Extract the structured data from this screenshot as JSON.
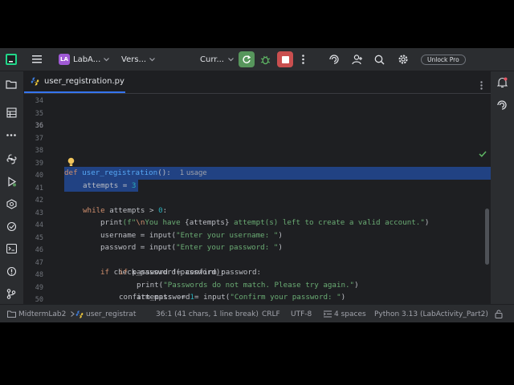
{
  "titlebar": {
    "project_badge": "LA",
    "project_name": "LabA...",
    "vcs_label": "Vers...",
    "run_config": "Curr...",
    "unlock_label": "Unlock Pro"
  },
  "tab": {
    "filename": "user_registration.py"
  },
  "editor": {
    "line_numbers": [
      "34",
      "35",
      "36",
      "37",
      "38",
      "39",
      "40",
      "41",
      "42",
      "43",
      "44",
      "45",
      "46",
      "47",
      "48",
      "49",
      "50",
      "51"
    ],
    "current_line": "36",
    "usage_hint": "1 usage",
    "code": {
      "l36_kw": "def",
      "l36_fn": "user_registration",
      "l36_rest": "():",
      "l37_var": "attempts = ",
      "l37_num": "3",
      "l39_kw": "while",
      "l39_rest": " attempts > ",
      "l39_num": "0",
      "l39_colon": ":",
      "l40_fn": "print",
      "l40_open": "(f\"",
      "l40_esc": "\\n",
      "l40_s1": "You have ",
      "l40_expr": "{attempts}",
      "l40_s2": " attempt(s) left to create a valid account.\"",
      "l40_close": ")",
      "l41_pre": "username = ",
      "l41_fn": "input",
      "l41_str": "\"Enter your username: \"",
      "l42_pre": "password = ",
      "l42_fn": "input",
      "l42_str": "\"Enter your password: \"",
      "l44_kw": "if",
      "l44_rest": " check_password(password):",
      "l46_pre": "confirm_password = ",
      "l46_fn": "input",
      "l46_str": "\"Confirm your password: \"",
      "l48_kw": "if",
      "l48_rest": " password != confirm_password:",
      "l49_fn": "print",
      "l49_str": "\"Passwords do not match. Please try again.\"",
      "l50_pre": "attempts -= ",
      "l50_num": "1"
    }
  },
  "statusbar": {
    "project": "MidtermLab2",
    "file": "user_registrat",
    "position": "36:1 (41 chars, 1 line break)",
    "line_ending": "CRLF",
    "encoding": "UTF-8",
    "indent": "4 spaces",
    "interpreter": "Python 3.13 (LabActivity_Part2)"
  },
  "colors": {
    "accent": "#3574f0",
    "run_green": "#57965c",
    "stop_red": "#c94f4f",
    "selection": "#214283"
  }
}
